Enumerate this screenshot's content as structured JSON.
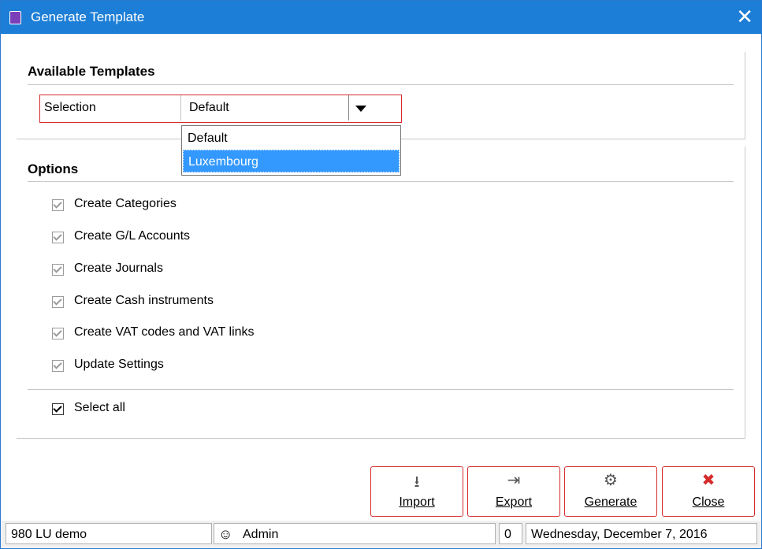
{
  "window": {
    "title": "Generate Template",
    "accent": "#1c7ed6",
    "close_icon": "close-icon"
  },
  "templates": {
    "heading": "Available Templates",
    "selection_label": "Selection",
    "selected_value": "Default",
    "options": [
      "Default",
      "Luxembourg"
    ],
    "highlighted": "Luxembourg"
  },
  "options_section": {
    "heading": "Options",
    "items": [
      {
        "label": "Create Categories",
        "checked": true
      },
      {
        "label": "Create G/L Accounts",
        "checked": true
      },
      {
        "label": "Create Journals",
        "checked": true
      },
      {
        "label": "Create Cash instruments",
        "checked": true
      },
      {
        "label": "Create VAT codes and VAT links",
        "checked": true
      },
      {
        "label": "Update Settings",
        "checked": true
      }
    ],
    "select_all": {
      "label": "Select all",
      "checked": true
    }
  },
  "buttons": {
    "import": {
      "label": "Import",
      "icon": "download-icon"
    },
    "export": {
      "label": "Export",
      "icon": "export-icon"
    },
    "generate": {
      "label": "Generate",
      "icon": "gear-icon"
    },
    "close": {
      "label": "Close",
      "icon": "close-icon"
    }
  },
  "status_bar": {
    "company": "980 LU demo",
    "user": "Admin",
    "count": "0",
    "date": "Wednesday, December 7, 2016"
  }
}
